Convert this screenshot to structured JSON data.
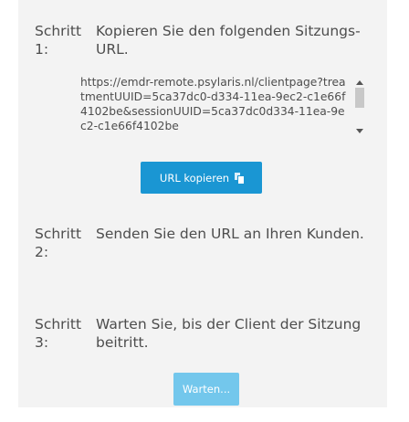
{
  "steps": [
    {
      "label": "Schritt 1:",
      "text": "Kopieren Sie den folgenden Sitzungs-URL."
    },
    {
      "label": "Schritt 2:",
      "text": "Senden Sie den URL an Ihren Kunden."
    },
    {
      "label": "Schritt 3:",
      "text": "Warten Sie, bis der Client der Sitzung beitritt."
    }
  ],
  "session_url": "https://emdr-remote.psylaris.nl/clientpage?treatmentUUID=5ca37dc0-d334-11ea-9ec2-c1e66f4102be&sessionUUID=5ca37dc0d334-11ea-9ec2-c1e66f4102be",
  "buttons": {
    "copy_label": "URL kopieren",
    "wait_label": "Warten..."
  },
  "icons": {
    "copy": "copy-icon",
    "scroll_up": "scroll-up-arrow",
    "scroll_down": "scroll-down-arrow"
  },
  "colors": {
    "panel_bg": "#f3f3f3",
    "primary_button": "#1a96d3",
    "disabled_button": "#73c7ec",
    "text": "#4d4d4d"
  }
}
